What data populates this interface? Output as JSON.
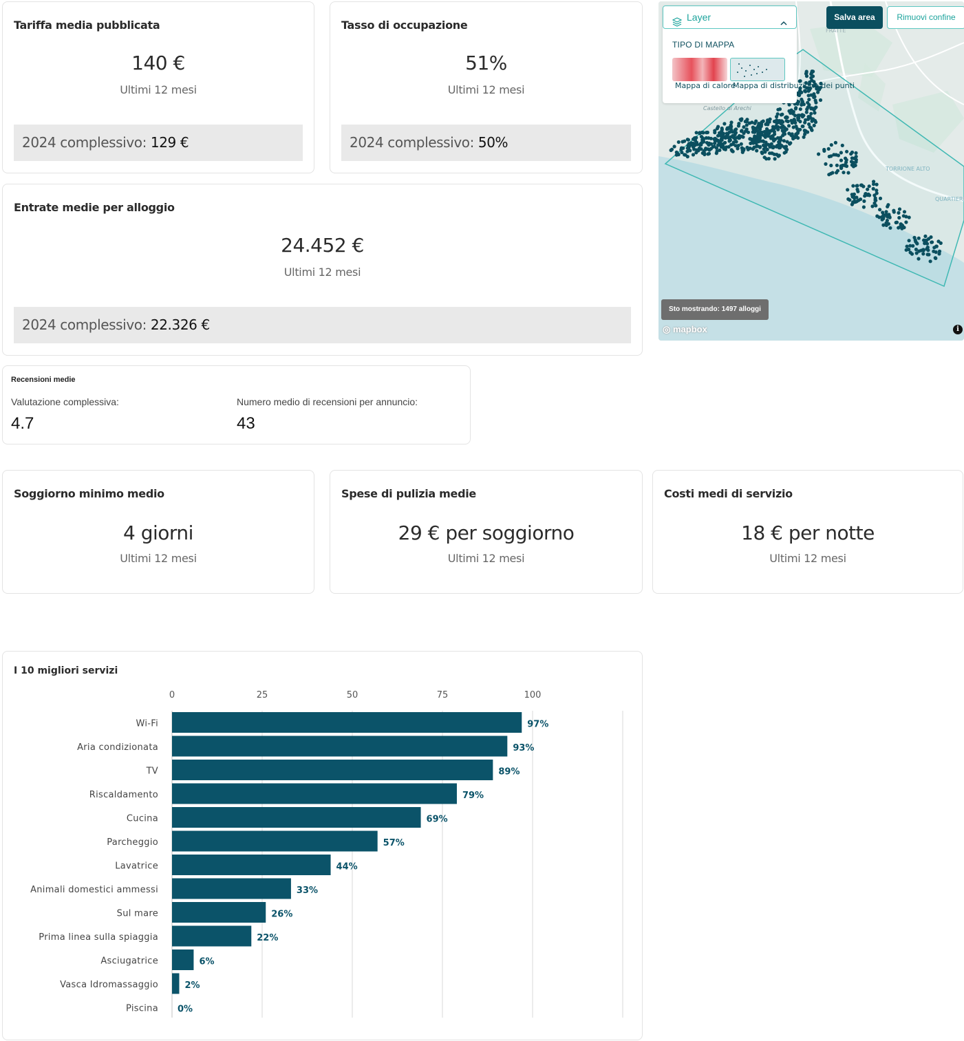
{
  "kpis": {
    "tariffa": {
      "title": "Tariffa media pubblicata",
      "value": "140 €",
      "period": "Ultimi 12 mesi",
      "year_label": "2024 complessivo:",
      "year_value": "129 €"
    },
    "occupazione": {
      "title": "Tasso di occupazione",
      "value": "51%",
      "period": "Ultimi 12 mesi",
      "year_label": "2024 complessivo:",
      "year_value": "50%"
    },
    "entrate": {
      "title": "Entrate medie per alloggio",
      "value": "24.452 €",
      "period": "Ultimi 12 mesi",
      "year_label": "2024 complessivo:",
      "year_value": "22.326 €"
    },
    "soggiorno": {
      "title": "Soggiorno minimo medio",
      "value": "4 giorni",
      "period": "Ultimi 12 mesi"
    },
    "pulizia": {
      "title": "Spese di pulizia medie",
      "value": "29 € per soggiorno",
      "period": "Ultimi 12 mesi"
    },
    "servizio": {
      "title": "Costi medi di servizio",
      "value": "18 € per notte",
      "period": "Ultimi 12 mesi"
    }
  },
  "reviews": {
    "title": "Recensioni medie",
    "overall_label": "Valutazione complessiva:",
    "overall_value": "4.7",
    "count_label": "Numero medio di recensioni per annuncio:",
    "count_value": "43"
  },
  "map": {
    "layer_label": "Layer",
    "tipo_label": "TIPO DI MAPPA",
    "heat_label": "Mappa di calore",
    "dots_label": "Mappa di distribuzione dei punti",
    "save_label": "Salva area",
    "remove_label": "Rimuovi confine",
    "showing_label": "Sto mostrando: 1497 alloggi",
    "attribution": "mapbox",
    "place_labels": [
      "FRATTE",
      "Castello di Arechi",
      "TORRIONE ALTO",
      "QUARTIERE ITALIA"
    ],
    "colors": {
      "dots": "#0b4f5f",
      "boundary": "#3fb8b3",
      "water": "#c5e0e6"
    }
  },
  "chart_data": {
    "type": "bar",
    "orientation": "horizontal",
    "title": "I 10 migliori servizi",
    "categories": [
      "Wi-Fi",
      "Aria condizionata",
      "TV",
      "Riscaldamento",
      "Cucina",
      "Parcheggio",
      "Lavatrice",
      "Animali domestici ammessi",
      "Sul mare",
      "Prima linea sulla spiaggia",
      "Asciugatrice",
      "Vasca Idromassaggio",
      "Piscina"
    ],
    "values": [
      97,
      93,
      89,
      79,
      69,
      57,
      44,
      33,
      26,
      22,
      6,
      2,
      0
    ],
    "value_labels": [
      "97%",
      "93%",
      "89%",
      "79%",
      "69%",
      "57%",
      "44%",
      "33%",
      "26%",
      "22%",
      "6%",
      "2%",
      "0%"
    ],
    "ticks": [
      "0",
      "25",
      "50",
      "75",
      "100"
    ],
    "xlim": [
      0,
      125
    ],
    "grid": true,
    "color": "#0b5369"
  }
}
